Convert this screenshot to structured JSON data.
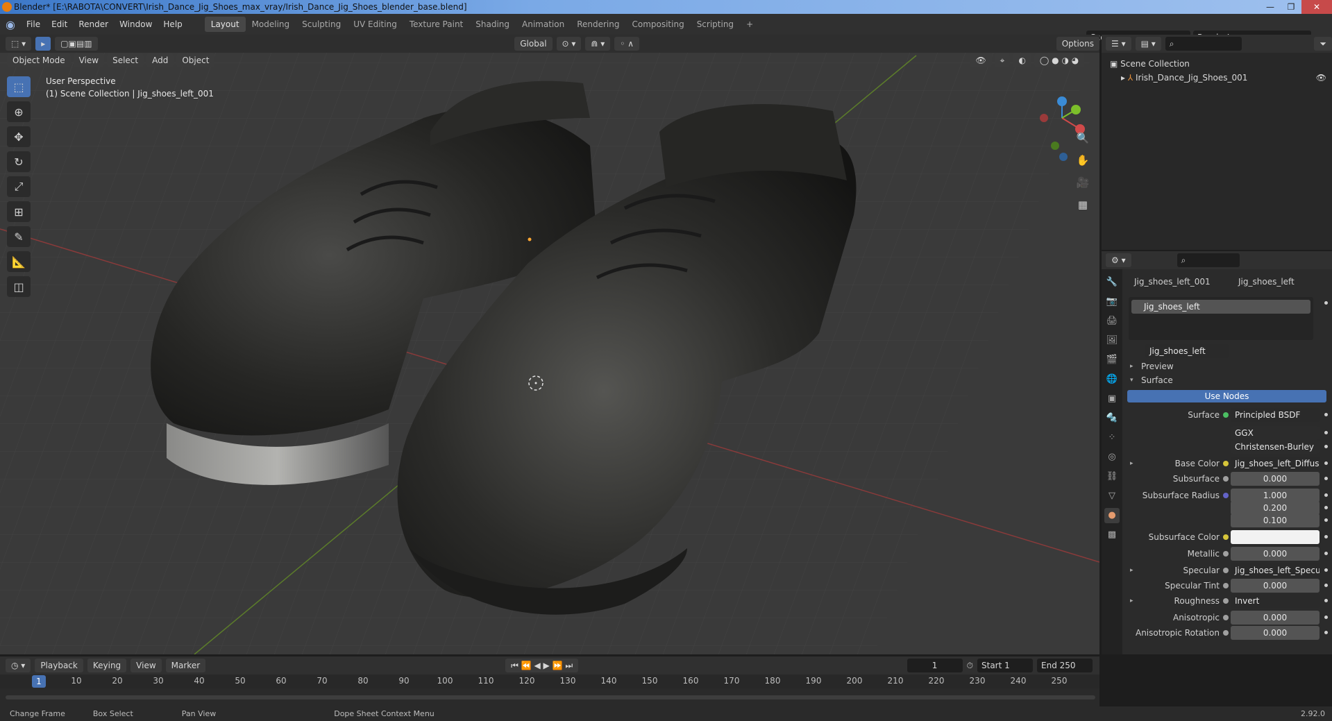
{
  "window": {
    "title": "Blender* [E:\\RABOTA\\CONVERT\\Irish_Dance_Jig_Shoes_max_vray/Irish_Dance_Jig_Shoes_blender_base.blend]"
  },
  "menu": [
    "File",
    "Edit",
    "Render",
    "Window",
    "Help"
  ],
  "workspaces": [
    "Layout",
    "Modeling",
    "Sculpting",
    "UV Editing",
    "Texture Paint",
    "Shading",
    "Animation",
    "Rendering",
    "Compositing",
    "Scripting"
  ],
  "scene": {
    "name": "Scene",
    "render_layer": "RenderLayer"
  },
  "viewport": {
    "mode": "Object Mode",
    "menus": [
      "View",
      "Select",
      "Add",
      "Object"
    ],
    "orientation": "Global",
    "options": "Options",
    "info_line1": "User Perspective",
    "info_line2": "(1) Scene Collection | Jig_shoes_left_001"
  },
  "outliner": {
    "collection": "Scene Collection",
    "object": "Irish_Dance_Jig_Shoes_001"
  },
  "properties": {
    "object_name": "Jig_shoes_left_001",
    "material_name": "Jig_shoes_left",
    "slot": "Jig_shoes_left",
    "material_field": "Jig_shoes_left",
    "preview": "Preview",
    "surface_section": "Surface",
    "use_nodes": "Use Nodes",
    "rows": [
      {
        "label": "Surface",
        "value": "Principled BSDF",
        "dot": "#4bbf62"
      },
      {
        "label": "",
        "value": "GGX",
        "dot": ""
      },
      {
        "label": "",
        "value": "Christensen-Burley",
        "dot": ""
      },
      {
        "label": "Base Color",
        "value": "Jig_shoes_left_Diffuse.png",
        "dot": "#d6c53a"
      },
      {
        "label": "Subsurface",
        "value": "0.000",
        "dot": "#a0a0a0"
      },
      {
        "label": "Subsurface Radius",
        "value": "1.000",
        "dot": "#6363c7"
      },
      {
        "label": "",
        "value": "0.200",
        "dot": ""
      },
      {
        "label": "",
        "value": "0.100",
        "dot": ""
      },
      {
        "label": "Subsurface Color",
        "value": "",
        "dot": "#d6c53a"
      },
      {
        "label": "Metallic",
        "value": "0.000",
        "dot": "#a0a0a0"
      },
      {
        "label": "Specular",
        "value": "Jig_shoes_left_Specular.pn",
        "dot": "#a0a0a0"
      },
      {
        "label": "Specular Tint",
        "value": "0.000",
        "dot": "#a0a0a0"
      },
      {
        "label": "Roughness",
        "value": "Invert",
        "dot": "#a0a0a0"
      },
      {
        "label": "Anisotropic",
        "value": "0.000",
        "dot": "#a0a0a0"
      },
      {
        "label": "Anisotropic Rotation",
        "value": "0.000",
        "dot": "#a0a0a0"
      }
    ]
  },
  "timeline": {
    "menus": [
      "Playback",
      "Keying",
      "View",
      "Marker"
    ],
    "current_frame": "1",
    "start_label": "Start",
    "start": "1",
    "end_label": "End",
    "end": "250",
    "ticks": [
      "1",
      "10",
      "20",
      "30",
      "40",
      "50",
      "60",
      "70",
      "80",
      "90",
      "100",
      "110",
      "120",
      "130",
      "140",
      "150",
      "160",
      "170",
      "180",
      "190",
      "200",
      "210",
      "220",
      "230",
      "240",
      "250"
    ]
  },
  "status": {
    "change_frame": "Change Frame",
    "box_select": "Box Select",
    "pan_view": "Pan View",
    "context_menu": "Dope Sheet Context Menu",
    "version": "2.92.0"
  }
}
